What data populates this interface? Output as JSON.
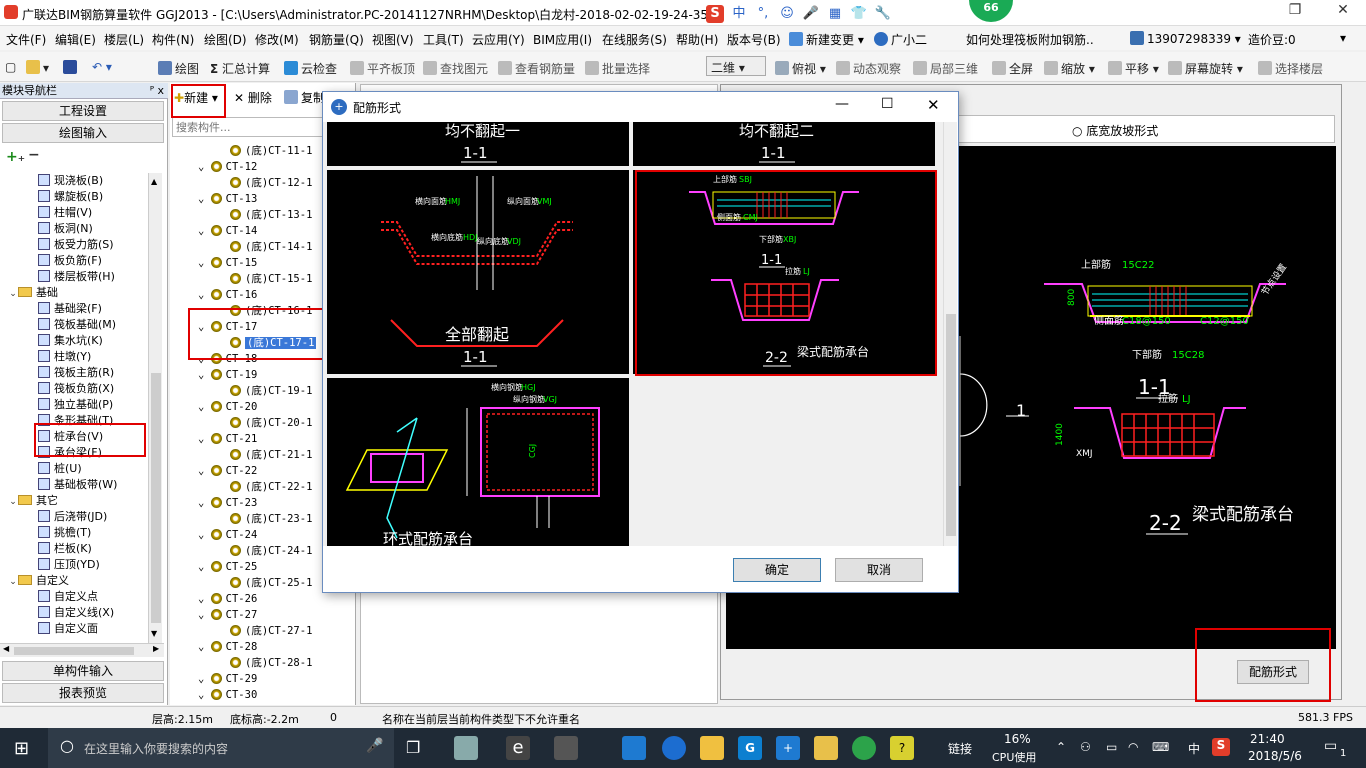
{
  "titlebar": {
    "title": "广联达BIM钢筋算量软件 GGJ2013 - [C:\\Users\\Administrator.PC-20141127NRHM\\Desktop\\白龙村-2018-02-02-19-24-35",
    "ime": [
      "S",
      "中",
      "°,",
      "☺",
      "🎤",
      "▦",
      "👕",
      "🔧"
    ],
    "badge": "66",
    "restore": "❐",
    "close": "✕"
  },
  "menubar": {
    "items": [
      "文件(F)",
      "编辑(E)",
      "楼层(L)",
      "构件(N)",
      "绘图(D)",
      "修改(M)",
      "钢筋量(Q)",
      "视图(V)",
      "工具(T)",
      "云应用(Y)",
      "BIM应用(I)",
      "在线服务(S)",
      "帮助(H)",
      "版本号(B)",
      "新建变更",
      "广小二"
    ],
    "question": "如何处理筏板附加钢筋..",
    "phone": "13907298339",
    "beans": "造价豆:0"
  },
  "toolbar": {
    "draw": "绘图",
    "sum": "汇总计算",
    "cloud_check": "云检查",
    "align_top": "平齐板顶",
    "find": "查找图元",
    "view_rebar": "查看钢筋量",
    "batch_select": "批量选择",
    "view_mode": "二维",
    "look": "俯视",
    "dynamic": "动态观察",
    "local3d": "局部三维",
    "fullscreen": "全屏",
    "zoom": "缩放",
    "pan": "平移",
    "rotate": "屏幕旋转",
    "select_floor": "选择楼层"
  },
  "nav": {
    "header": "模块导航栏",
    "pin": "ᴾ x",
    "project_settings": "工程设置",
    "drawing_input": "绘图输入",
    "single_input": "单构件输入",
    "report_preview": "报表预览",
    "tree": [
      {
        "label": "现浇板(B)",
        "indent": 2
      },
      {
        "label": "螺旋板(B)",
        "indent": 2
      },
      {
        "label": "柱帽(V)",
        "indent": 2
      },
      {
        "label": "板洞(N)",
        "indent": 2
      },
      {
        "label": "板受力筋(S)",
        "indent": 2
      },
      {
        "label": "板负筋(F)",
        "indent": 2
      },
      {
        "label": "楼层板带(H)",
        "indent": 2
      },
      {
        "label": "基础",
        "indent": 1,
        "folder": true
      },
      {
        "label": "基础梁(F)",
        "indent": 2
      },
      {
        "label": "筏板基础(M)",
        "indent": 2
      },
      {
        "label": "集水坑(K)",
        "indent": 2
      },
      {
        "label": "柱墩(Y)",
        "indent": 2
      },
      {
        "label": "筏板主筋(R)",
        "indent": 2
      },
      {
        "label": "筏板负筋(X)",
        "indent": 2
      },
      {
        "label": "独立基础(P)",
        "indent": 2
      },
      {
        "label": "条形基础(T)",
        "indent": 2
      },
      {
        "label": "桩承台(V)",
        "indent": 2
      },
      {
        "label": "承台梁(F)",
        "indent": 2
      },
      {
        "label": "桩(U)",
        "indent": 2
      },
      {
        "label": "基础板带(W)",
        "indent": 2
      },
      {
        "label": "其它",
        "indent": 1,
        "folder": true
      },
      {
        "label": "后浇带(JD)",
        "indent": 2
      },
      {
        "label": "挑檐(T)",
        "indent": 2
      },
      {
        "label": "栏板(K)",
        "indent": 2
      },
      {
        "label": "压顶(YD)",
        "indent": 2
      },
      {
        "label": "自定义",
        "indent": 1,
        "folder": true
      },
      {
        "label": "自定义点",
        "indent": 2
      },
      {
        "label": "自定义线(X)",
        "indent": 2
      },
      {
        "label": "自定义面",
        "indent": 2
      }
    ]
  },
  "list": {
    "new": "新建",
    "delete": "删除",
    "copy": "复制",
    "search_placeholder": "搜索构件...",
    "rows": [
      {
        "label": "(底)CT-11-1",
        "child": true
      },
      {
        "label": "CT-12",
        "child": false
      },
      {
        "label": "(底)CT-12-1",
        "child": true
      },
      {
        "label": "CT-13",
        "child": false
      },
      {
        "label": "(底)CT-13-1",
        "child": true
      },
      {
        "label": "CT-14",
        "child": false
      },
      {
        "label": "(底)CT-14-1",
        "child": true
      },
      {
        "label": "CT-15",
        "child": false
      },
      {
        "label": "(底)CT-15-1",
        "child": true
      },
      {
        "label": "CT-16",
        "child": false
      },
      {
        "label": "(底)CT-16-1",
        "child": true
      },
      {
        "label": "CT-17",
        "child": false
      },
      {
        "label": "(底)CT-17-1",
        "child": true,
        "selected": true
      },
      {
        "label": "CT-18",
        "child": false
      },
      {
        "label": "CT-19",
        "child": false
      },
      {
        "label": "(底)CT-19-1",
        "child": true
      },
      {
        "label": "CT-20",
        "child": false
      },
      {
        "label": "(底)CT-20-1",
        "child": true
      },
      {
        "label": "CT-21",
        "child": false
      },
      {
        "label": "(底)CT-21-1",
        "child": true
      },
      {
        "label": "CT-22",
        "child": false
      },
      {
        "label": "(底)CT-22-1",
        "child": true
      },
      {
        "label": "CT-23",
        "child": false
      },
      {
        "label": "(底)CT-23-1",
        "child": true
      },
      {
        "label": "CT-24",
        "child": false
      },
      {
        "label": "(底)CT-24-1",
        "child": true
      },
      {
        "label": "CT-25",
        "child": false
      },
      {
        "label": "(底)CT-25-1",
        "child": true
      },
      {
        "label": "CT-26",
        "child": false
      },
      {
        "label": "CT-27",
        "child": false
      },
      {
        "label": "(底)CT-27-1",
        "child": true
      },
      {
        "label": "CT-28",
        "child": false
      },
      {
        "label": "(底)CT-28-1",
        "child": true
      },
      {
        "label": "CT-29",
        "child": false
      },
      {
        "label": "CT-30",
        "child": false
      }
    ]
  },
  "preview": {
    "radio_label": "底宽放坡形式",
    "rebar_form_button": "配筋形式",
    "top_bar": "上部筋",
    "top_bar_spec": "15C22",
    "side_bar": "侧面筋",
    "side_bar_spec": "C18@150",
    "side_bar_spec2": "C12@150",
    "bottom_bar": "下部筋",
    "bottom_bar_spec": "15C28",
    "section11": "1-1",
    "section22": "2-2",
    "tie": "拉筋",
    "tie_code": "LJ",
    "beam_cap": "梁式配筋承台",
    "slope_note": "节点设置",
    "dim_left": "1400",
    "dim_top": "800",
    "xmj": "XMJ",
    "number_one": "1"
  },
  "dialog": {
    "title": "配筋形式",
    "p1_text": "均不翻起一",
    "p1_section": "1-1",
    "p2_text": "均不翻起二",
    "p2_section": "1-1",
    "p3_label_h": "横向面筋",
    "p3_label_v": "纵向面筋",
    "p3_code_h": "HMJ",
    "p3_code_v": "VMJ",
    "p3_label_hd": "横向底筋",
    "p3_label_vd": "纵向底筋",
    "p3_code_hd": "HDJ",
    "p3_code_vd": "VDJ",
    "p3_text": "全部翻起",
    "p3_section": "1-1",
    "p4_top": "上部筋",
    "p4_top_code": "SBJ",
    "p4_side": "侧面筋",
    "p4_side_code": "CMJ",
    "p4_bottom": "下部筋",
    "p4_bottom_code": "XBJ",
    "p4_section1": "1-1",
    "p4_tie": "拉筋",
    "p4_tie_code": "LJ",
    "p4_section2": "2-2",
    "p4_text": "梁式配筋承台",
    "p5_label_h": "横向钢筋",
    "p5_code_h": "HGJ",
    "p5_label_v": "纵向钢筋",
    "p5_code_v": "VGJ",
    "p5_code_c": "CGJ",
    "p5_text": "环式配筋承台",
    "confirm": "确定",
    "cancel": "取消"
  },
  "statusbar": {
    "floor_height": "层高:2.15m",
    "base_height": "底标高:-2.2m",
    "zero": "0",
    "message": "名称在当前层当前构件类型下不允许重名",
    "fps": "581.3 FPS"
  },
  "taskbar": {
    "search_placeholder": "在这里输入你要搜索的内容",
    "link": "链接",
    "cpu_value": "16%",
    "cpu_label": "CPU使用",
    "lang": "中",
    "time": "21:40",
    "date": "2018/5/6",
    "notify": "1"
  },
  "colors": {
    "highlight_red": "#e00000",
    "selected_blue": "#3a78d8",
    "cad_green": "#00ff00",
    "cad_red": "#ff2020",
    "cad_yellow": "#ffff00",
    "cad_magenta": "#ff40ff",
    "cad_cyan": "#40ffff",
    "taskbar": "#1f2a36"
  }
}
